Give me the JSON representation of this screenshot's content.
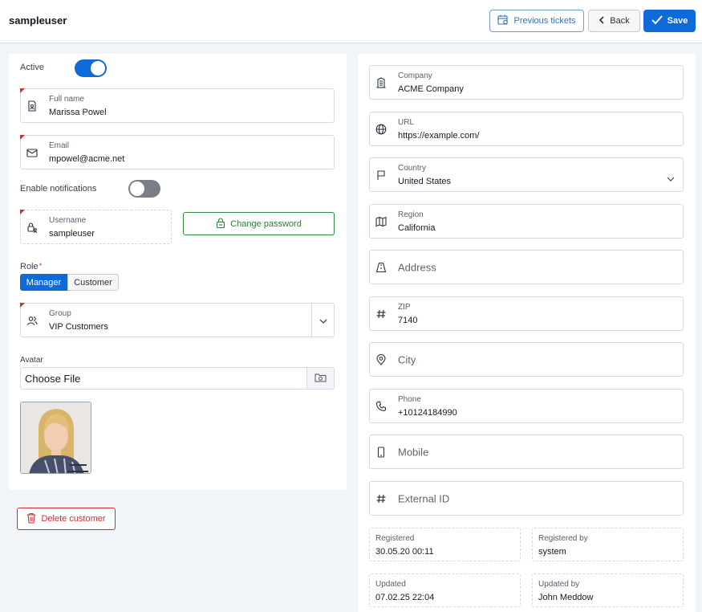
{
  "header": {
    "title": "sampleuser",
    "previous_tickets_label": "Previous tickets",
    "back_label": "Back",
    "save_label": "Save"
  },
  "left": {
    "active_label": "Active",
    "active_on": true,
    "full_name": {
      "label": "Full name",
      "value": "Marissa Powel"
    },
    "email": {
      "label": "Email",
      "value": "mpowel@acme.net"
    },
    "notifications_label": "Enable notifications",
    "notifications_on": false,
    "username": {
      "label": "Username",
      "value": "sampleuser"
    },
    "change_password_label": "Change password",
    "role_label": "Role",
    "role_required_mark": "*",
    "roles": [
      "Manager",
      "Customer"
    ],
    "role_selected": "Manager",
    "group": {
      "label": "Group",
      "value": "VIP Customers"
    },
    "avatar_label": "Avatar",
    "choose_file_label": "Choose File",
    "delete_label": "Delete customer"
  },
  "right": {
    "company": {
      "label": "Company",
      "value": "ACME Company"
    },
    "url": {
      "label": "URL",
      "value": "https://example.com/"
    },
    "country": {
      "label": "Country",
      "value": "United States"
    },
    "region": {
      "label": "Region",
      "value": "California"
    },
    "address": {
      "placeholder": "Address"
    },
    "zip": {
      "label": "ZIP",
      "value": "7140"
    },
    "city": {
      "placeholder": "City"
    },
    "phone": {
      "label": "Phone",
      "value": "+10124184990"
    },
    "mobile": {
      "placeholder": "Mobile"
    },
    "external_id": {
      "placeholder": "External ID"
    },
    "registered": {
      "label": "Registered",
      "value": "30.05.20 00:11"
    },
    "registered_by": {
      "label": "Registered by",
      "value": "system"
    },
    "updated": {
      "label": "Updated",
      "value": "07.02.25 22:04"
    },
    "updated_by": {
      "label": "Updated by",
      "value": "John Meddow"
    }
  },
  "colors": {
    "primary": "#0f6ad9",
    "success": "#2f8a3a",
    "danger": "#cf2f33",
    "required": "#e0262a"
  }
}
